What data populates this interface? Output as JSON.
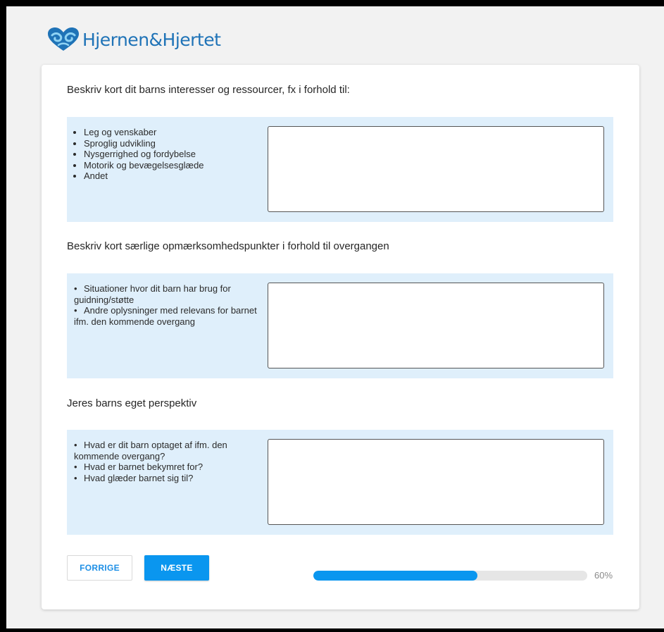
{
  "brand": {
    "name": "Hjernen&Hjertet",
    "color": "#1f73b7",
    "logo_icon": "heart-brain-icon"
  },
  "sections": [
    {
      "title": "Beskriv kort dit barns interesser og ressourcer, fx i forhold til:",
      "bullets": [
        "Leg og venskaber",
        "Sproglig udvikling",
        "Nysgerrighed og fordybelse",
        "Motorik og bevægelsesglæde",
        "Andet"
      ],
      "answer_value": ""
    },
    {
      "title": "Beskriv kort særlige opmærksomhedspunkter i forhold til overgangen",
      "bullets": [
        "Situationer hvor dit barn har brug for guidning/støtte",
        "Andre oplysninger med relevans for barnet ifm. den kommende overgang"
      ],
      "answer_value": ""
    },
    {
      "title": "Jeres barns eget perspektiv",
      "bullets": [
        "Hvad er dit barn optaget af ifm. den kommende overgang?",
        "Hvad er barnet bekymret for?",
        "Hvad glæder barnet sig til?"
      ],
      "answer_value": ""
    }
  ],
  "nav": {
    "prev_label": "FORRIGE",
    "next_label": "NÆSTE"
  },
  "progress": {
    "value": 0.6,
    "label": "60%"
  },
  "colors": {
    "accent": "#0a96ef",
    "panel": "#dfeffb"
  }
}
